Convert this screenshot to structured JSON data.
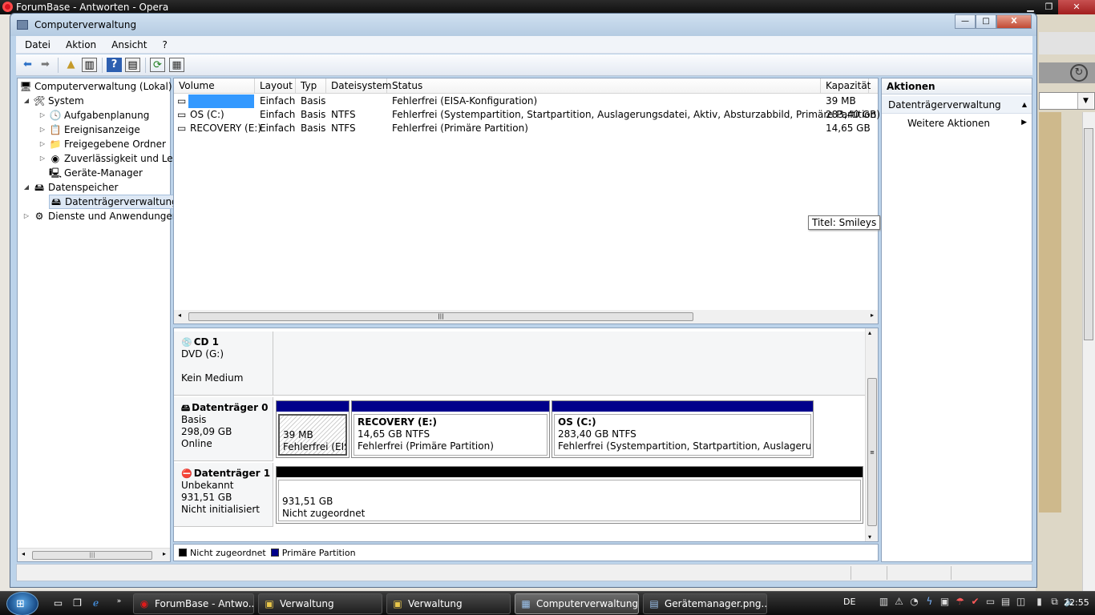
{
  "opera": {
    "title": "ForumBase - Antworten - Opera"
  },
  "window": {
    "title": "Computerverwaltung",
    "controls": {
      "minimize": "—",
      "maximize": "□",
      "close": "X"
    }
  },
  "menu": [
    "Datei",
    "Aktion",
    "Ansicht",
    "?"
  ],
  "toolbar_icons": [
    "back-arrow-icon",
    "forward-arrow-icon",
    "up-folder-icon",
    "show-hide-tree-icon",
    "help-icon",
    "show-hide-action-icon",
    "refresh-icon",
    "properties-icon"
  ],
  "tree": {
    "root": "Computerverwaltung (Lokal)",
    "system": "System",
    "aufgabenplanung": "Aufgabenplanung",
    "ereignisanzeige": "Ereignisanzeige",
    "freigegebene": "Freigegebene Ordner",
    "zuverlaessigkeit": "Zuverlässigkeit und Leis",
    "geraete": "Geräte-Manager",
    "datenspeicher": "Datenspeicher",
    "datentraeger": "Datenträgerverwaltung",
    "dienste": "Dienste und Anwendungen"
  },
  "volumes": {
    "columns": [
      "Volume",
      "Layout",
      "Typ",
      "Dateisystem",
      "Status",
      "Kapazität"
    ],
    "rows": [
      {
        "volume": "",
        "layout": "Einfach",
        "typ": "Basis",
        "fs": "",
        "status": "Fehlerfrei (EISA-Konfiguration)",
        "cap": "39 MB"
      },
      {
        "volume": "OS (C:)",
        "layout": "Einfach",
        "typ": "Basis",
        "fs": "NTFS",
        "status": "Fehlerfrei (Systempartition, Startpartition, Auslagerungsdatei, Aktiv, Absturzabbild, Primäre Partition)",
        "cap": "283,40 GB"
      },
      {
        "volume": "RECOVERY (E:)",
        "layout": "Einfach",
        "typ": "Basis",
        "fs": "NTFS",
        "status": "Fehlerfrei (Primäre Partition)",
        "cap": "14,65 GB"
      }
    ]
  },
  "tooltip": "Titel: Smileys",
  "disks": {
    "cd1": {
      "name": "CD 1",
      "type": "DVD (G:)",
      "state": "Kein Medium"
    },
    "d0": {
      "name": "Datenträger 0",
      "type": "Basis",
      "size": "298,09 GB",
      "state": "Online",
      "p1": {
        "size": "39 MB",
        "status": "Fehlerfrei (EISA"
      },
      "p2": {
        "name": "RECOVERY  (E:)",
        "size": "14,65 GB NTFS",
        "status": "Fehlerfrei (Primäre Partition)"
      },
      "p3": {
        "name": "OS  (C:)",
        "size": "283,40 GB NTFS",
        "status": "Fehlerfrei (Systempartition, Startpartition, Auslagerungsdatei"
      }
    },
    "d1": {
      "name": "Datenträger 1",
      "type": "Unbekannt",
      "size": "931,51 GB",
      "state": "Nicht initialisiert",
      "p1": {
        "size": "931,51 GB",
        "status": "Nicht zugeordnet"
      }
    }
  },
  "legend": {
    "unallocated": "Nicht zugeordnet",
    "primary": "Primäre Partition"
  },
  "colors": {
    "primary": "#00008b",
    "unallocated": "#000000",
    "selection": "#3399ff"
  },
  "actions": {
    "header": "Aktionen",
    "section": "Datenträgerverwaltung",
    "more": "Weitere Aktionen"
  },
  "taskbar": {
    "tasks": [
      "ForumBase - Antwo...",
      "Verwaltung",
      "Verwaltung",
      "Computerverwaltung",
      "Gerätemanager.png..."
    ],
    "lang": "DE",
    "clock": "22:55"
  }
}
